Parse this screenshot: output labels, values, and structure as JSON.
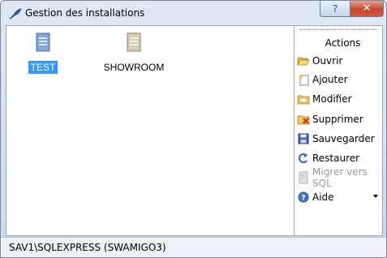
{
  "window": {
    "title": "Gestion des installations",
    "help_glyph": "?",
    "close_glyph": "✕"
  },
  "installations": [
    {
      "label": "TEST",
      "selected": true,
      "icon": "database-file-icon"
    },
    {
      "label": "SHOWROOM",
      "selected": false,
      "icon": "database-file-icon"
    }
  ],
  "actions": {
    "title": "Actions",
    "items": [
      {
        "label": "Ouvrir",
        "icon": "open-folder-icon",
        "enabled": true
      },
      {
        "label": "Ajouter",
        "icon": "new-item-icon",
        "enabled": true
      },
      {
        "label": "Modifier",
        "icon": "edit-folder-icon",
        "enabled": true
      },
      {
        "label": "Supprimer",
        "icon": "delete-icon",
        "enabled": true
      },
      {
        "label": "Sauvegarder",
        "icon": "save-disk-icon",
        "enabled": true
      },
      {
        "label": "Restaurer",
        "icon": "restore-arrow-icon",
        "enabled": true
      },
      {
        "label": "Migrer vers SQL",
        "icon": "migrate-icon",
        "enabled": false
      },
      {
        "label": "Aide",
        "icon": "help-icon",
        "enabled": true,
        "has_dropdown": true
      }
    ]
  },
  "status": {
    "text": "SAV1\\SQLEXPRESS (SWAMIGO3)"
  },
  "colors": {
    "selection": "#3399ff",
    "title_bar": "#dfe9f5",
    "close_button": "#c7452c"
  }
}
